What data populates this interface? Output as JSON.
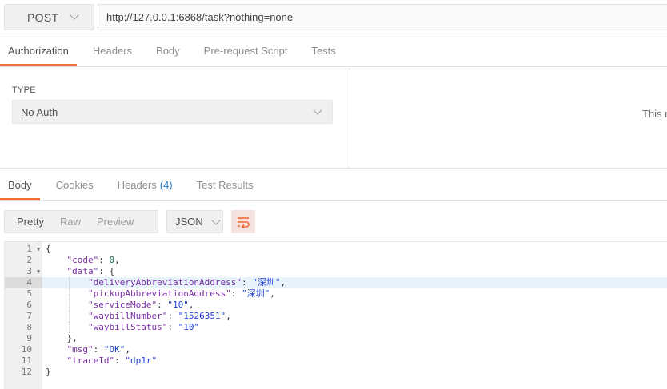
{
  "request": {
    "method": "POST",
    "url": "http://127.0.0.1:6868/task?nothing=none"
  },
  "request_tabs": [
    "Authorization",
    "Headers",
    "Body",
    "Pre-request Script",
    "Tests"
  ],
  "auth": {
    "type_label": "TYPE",
    "selected": "No Auth",
    "right_text": "This r"
  },
  "response_tabs": {
    "body": "Body",
    "cookies": "Cookies",
    "headers": "Headers",
    "headers_count": "(4)",
    "test_results": "Test Results"
  },
  "view_modes": [
    "Pretty",
    "Raw",
    "Preview"
  ],
  "format": "JSON",
  "icons": {
    "method_dropdown": "chevron-down-icon",
    "auth_dropdown": "chevron-down-icon",
    "format_dropdown": "chevron-down-icon",
    "wrap": "wrap-lines-icon",
    "fold": "fold-arrow-icon"
  },
  "colors": {
    "accent": "#f26b3a",
    "badge": "#2b7fd1",
    "json_key": "#7a2fa6",
    "json_string": "#1f3fd6",
    "json_number": "#116644"
  },
  "code": {
    "line_numbers": [
      "1",
      "2",
      "3",
      "4",
      "5",
      "6",
      "7",
      "8",
      "9",
      "10",
      "11",
      "12"
    ],
    "open_brace": "{",
    "code_key": "\"code\"",
    "code_value": "0",
    "data_key": "\"data\"",
    "delivery_key": "\"deliveryAbbreviationAddress\"",
    "delivery_value": "\"深圳\"",
    "pickup_key": "\"pickupAbbreviationAddress\"",
    "pickup_value": "\"深圳\"",
    "service_key": "\"serviceMode\"",
    "service_value": "\"10\"",
    "waybill_number_key": "\"waybillNumber\"",
    "waybill_number_value": "\"1526351\"",
    "waybill_status_key": "\"waybillStatus\"",
    "waybill_status_value": "\"10\"",
    "close_data": "},",
    "msg_key": "\"msg\"",
    "msg_value": "\"OK\"",
    "trace_key": "\"traceId\"",
    "trace_value": "\"dp1r\"",
    "close_brace": "}"
  }
}
